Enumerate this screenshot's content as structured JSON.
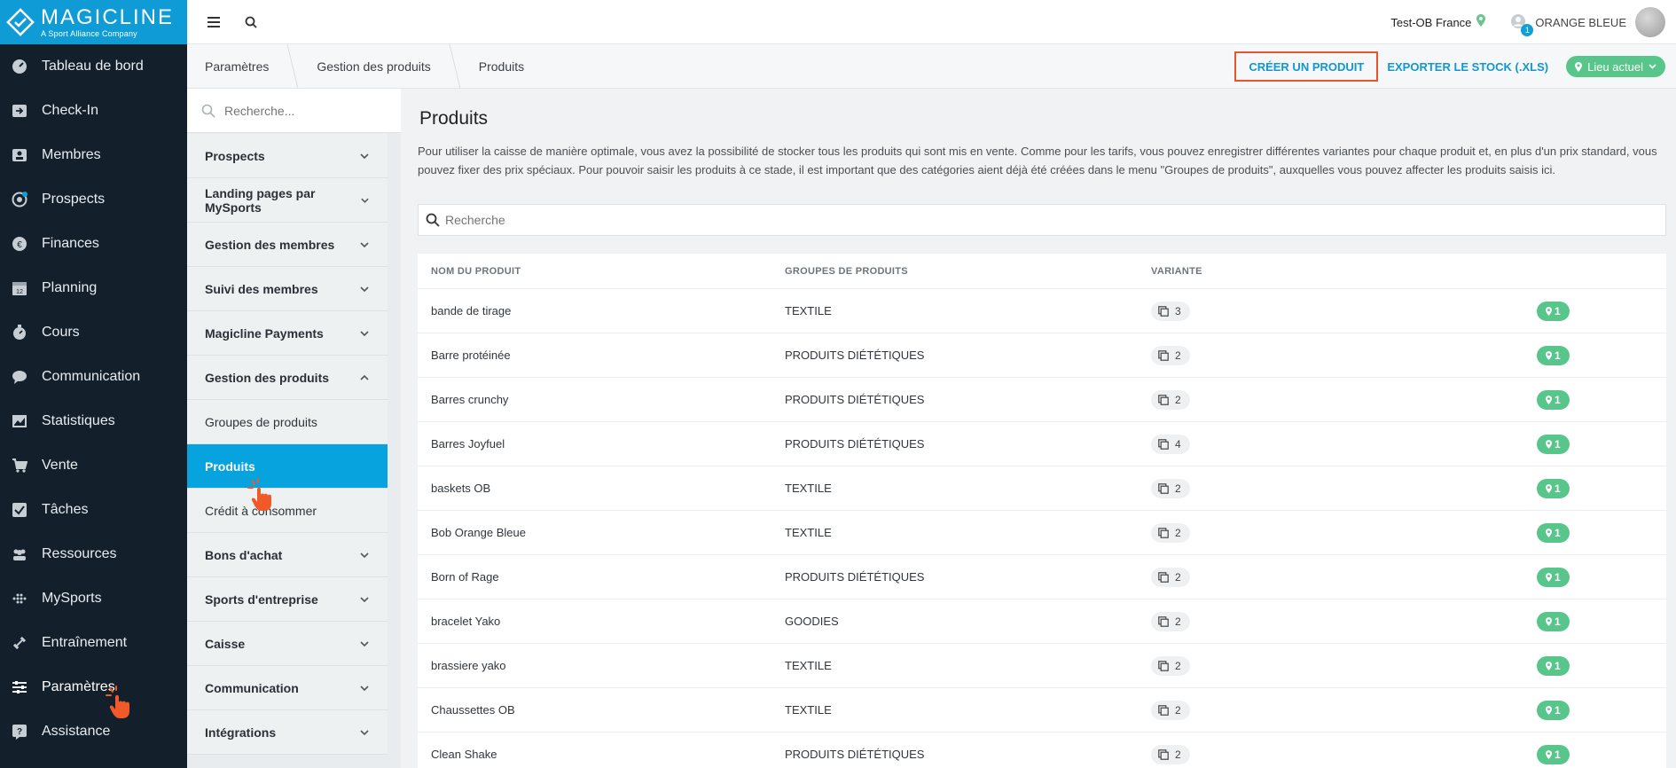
{
  "brand": {
    "name": "MAGICLINE",
    "tagline": "A Sport Alliance Company"
  },
  "nav": [
    {
      "label": "Tableau de bord",
      "icon": "dashboard-icon"
    },
    {
      "label": "Check-In",
      "icon": "checkin-icon"
    },
    {
      "label": "Membres",
      "icon": "members-icon"
    },
    {
      "label": "Prospects",
      "icon": "prospects-icon"
    },
    {
      "label": "Finances",
      "icon": "finances-icon"
    },
    {
      "label": "Planning",
      "icon": "calendar-icon"
    },
    {
      "label": "Cours",
      "icon": "stopwatch-icon"
    },
    {
      "label": "Communication",
      "icon": "chat-icon"
    },
    {
      "label": "Statistiques",
      "icon": "chart-icon"
    },
    {
      "label": "Vente",
      "icon": "cart-icon"
    },
    {
      "label": "Tâches",
      "icon": "task-icon"
    },
    {
      "label": "Ressources",
      "icon": "people-icon"
    },
    {
      "label": "MySports",
      "icon": "grid-icon"
    },
    {
      "label": "Entraînement",
      "icon": "dumbbell-icon"
    },
    {
      "label": "Paramètres",
      "icon": "sliders-icon"
    },
    {
      "label": "Assistance",
      "icon": "help-icon"
    }
  ],
  "topbar": {
    "studio": "Test-OB France",
    "org": "ORANGE BLEUE",
    "notif_count": "1"
  },
  "breadcrumb": [
    "Paramètres",
    "Gestion des produits",
    "Produits"
  ],
  "actions": {
    "create": "CRÉER UN PRODUIT",
    "export": "EXPORTER LE STOCK (.XLS)",
    "location": "Lieu actuel"
  },
  "subnav": {
    "search_placeholder": "Recherche...",
    "items": [
      {
        "label": "Prospects",
        "type": "group"
      },
      {
        "label": "Landing pages par MySports",
        "type": "group"
      },
      {
        "label": "Gestion des membres",
        "type": "group"
      },
      {
        "label": "Suivi des membres",
        "type": "group"
      },
      {
        "label": "Magicline Payments",
        "type": "group"
      },
      {
        "label": "Gestion des produits",
        "type": "group-open"
      },
      {
        "label": "Groupes de produits",
        "type": "child"
      },
      {
        "label": "Produits",
        "type": "child-active"
      },
      {
        "label": "Crédit à consommer",
        "type": "child"
      },
      {
        "label": "Bons d'achat",
        "type": "group"
      },
      {
        "label": "Sports d'entreprise",
        "type": "group"
      },
      {
        "label": "Caisse",
        "type": "group"
      },
      {
        "label": "Communication",
        "type": "group"
      },
      {
        "label": "Intégrations",
        "type": "group"
      }
    ]
  },
  "main": {
    "title": "Produits",
    "description": "Pour utiliser la caisse de manière optimale, vous avez la possibilité de stocker tous les produits qui sont mis en vente. Comme pour les tarifs, vous pouvez enregistrer différentes variantes pour chaque produit et, en plus d'un prix standard, vous pouvez fixer des prix spéciaux. Pour pouvoir saisir les produits à ce stade, il est important que des catégories aient déjà été créées dans le menu \"Groupes de produits\", auxquelles vous pouvez affecter les produits saisis ici.",
    "search_placeholder": "Recherche",
    "columns": [
      "NOM DU PRODUIT",
      "GROUPES DE PRODUITS",
      "VARIANTE"
    ],
    "rows": [
      {
        "name": "bande de tirage",
        "group": "TEXTILE",
        "variants": "3",
        "locations": "1"
      },
      {
        "name": "Barre protéinée",
        "group": "PRODUITS DIÉTÉTIQUES",
        "variants": "2",
        "locations": "1"
      },
      {
        "name": "Barres crunchy",
        "group": "PRODUITS DIÉTÉTIQUES",
        "variants": "2",
        "locations": "1"
      },
      {
        "name": "Barres Joyfuel",
        "group": "PRODUITS DIÉTÉTIQUES",
        "variants": "4",
        "locations": "1"
      },
      {
        "name": "baskets OB",
        "group": "TEXTILE",
        "variants": "2",
        "locations": "1"
      },
      {
        "name": "Bob Orange Bleue",
        "group": "TEXTILE",
        "variants": "2",
        "locations": "1"
      },
      {
        "name": "Born of Rage",
        "group": "PRODUITS DIÉTÉTIQUES",
        "variants": "2",
        "locations": "1"
      },
      {
        "name": "bracelet Yako",
        "group": "GOODIES",
        "variants": "2",
        "locations": "1"
      },
      {
        "name": "brassiere yako",
        "group": "TEXTILE",
        "variants": "2",
        "locations": "1"
      },
      {
        "name": "Chaussettes OB",
        "group": "TEXTILE",
        "variants": "2",
        "locations": "1"
      },
      {
        "name": "Clean Shake",
        "group": "PRODUITS DIÉTÉTIQUES",
        "variants": "2",
        "locations": "1"
      }
    ]
  },
  "colors": {
    "brand": "#0e9bd6",
    "nav_bg": "#13202c",
    "accent_green": "#58c68a",
    "highlight": "#e8542b"
  }
}
